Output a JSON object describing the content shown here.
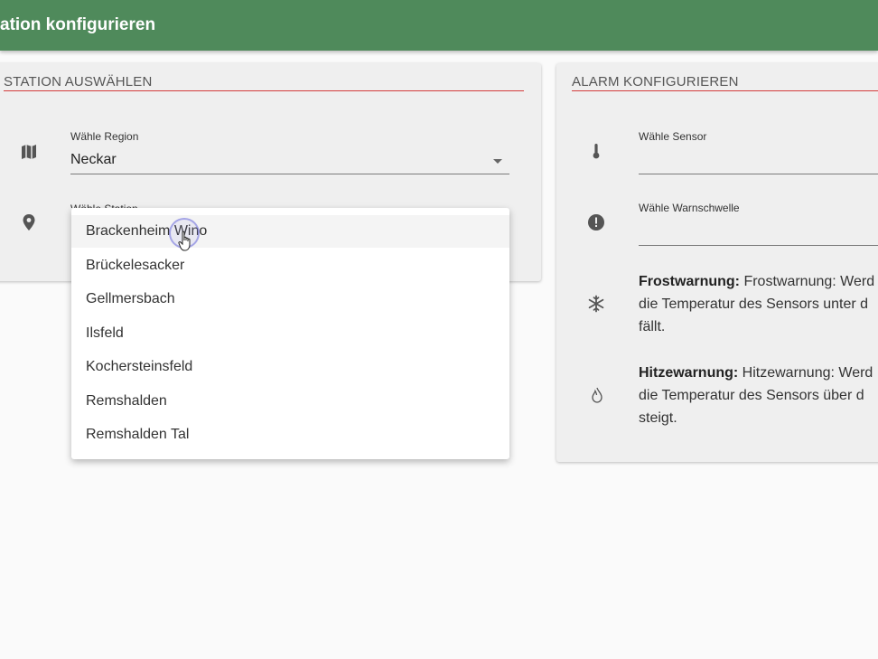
{
  "header": {
    "title": "ation konfigurieren"
  },
  "station_card": {
    "title": "STATION AUSWÄHLEN",
    "region": {
      "label": "Wähle Region",
      "value": "Neckar",
      "icon": "map-icon"
    },
    "station": {
      "label": "Wähle Station",
      "icon": "location-pin-icon"
    }
  },
  "alarm_card": {
    "title": "ALARM KONFIGURIEREN",
    "sensor": {
      "label": "Wähle Sensor",
      "icon": "thermometer-icon"
    },
    "threshold": {
      "label": "Wähle Warnschwelle",
      "icon": "alert-circle-icon"
    },
    "frost": {
      "icon": "snowflake-icon",
      "title": "Frostwarnung:",
      "line1": "Frostwarnung: Werd",
      "line2": "die Temperatur des Sensors unter d",
      "line3": "fällt."
    },
    "heat": {
      "icon": "flame-icon",
      "title": "Hitzewarnung:",
      "line1": "Hitzewarnung: Werd",
      "line2": "die Temperatur des Sensors über d",
      "line3": "steigt."
    }
  },
  "station_menu": {
    "items": [
      "Brackenheim Wino",
      "Brückelesacker",
      "Gellmersbach",
      "Ilsfeld",
      "Kochersteinsfeld",
      "Remshalden",
      "Remshalden Tal"
    ]
  },
  "colors": {
    "header": "#4f8a5b",
    "underline_accent": "#d43c3c",
    "card": "#efefef"
  }
}
